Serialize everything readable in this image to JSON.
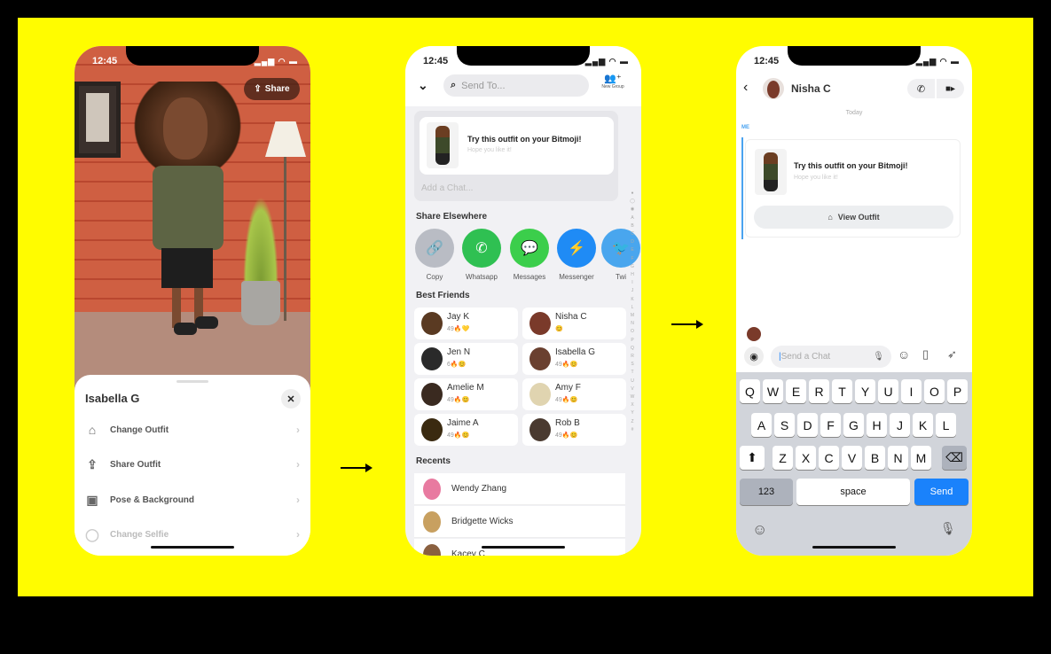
{
  "colors": {
    "brand_yellow": "#FFFC00",
    "send_blue": "#1a82fb",
    "accent_blue": "#4aa3f0"
  },
  "status": {
    "time": "12:45"
  },
  "screen1": {
    "share_button": "Share",
    "sheet_title": "Isabella G",
    "menu": [
      {
        "label": "Change Outfit",
        "icon": "hanger-icon"
      },
      {
        "label": "Share Outfit",
        "icon": "share-icon"
      },
      {
        "label": "Pose & Background",
        "icon": "image-icon"
      },
      {
        "label": "Change Selfie",
        "icon": "selfie-icon"
      }
    ]
  },
  "screen2": {
    "search_placeholder": "Send To...",
    "new_group": "New Group",
    "card_title": "Try this outfit on your Bitmoji!",
    "card_subtitle": "Hope you like it!",
    "add_chat_placeholder": "Add a Chat...",
    "share_heading": "Share Elsewhere",
    "share_targets": [
      {
        "label": "Copy",
        "color": "#b9bcc4",
        "icon": "link-icon"
      },
      {
        "label": "Whatsapp",
        "color": "#2fc052",
        "icon": "whatsapp-icon"
      },
      {
        "label": "Messages",
        "color": "#3bce4b",
        "icon": "message-icon"
      },
      {
        "label": "Messenger",
        "color": "#1f8bf5",
        "icon": "messenger-icon"
      },
      {
        "label": "Twi",
        "color": "#49a6ee",
        "icon": "twitter-icon"
      }
    ],
    "best_friends_heading": "Best Friends",
    "best_friends": [
      {
        "name": "Jay K",
        "streak": "49🔥💛"
      },
      {
        "name": "Nisha C",
        "streak": "😊"
      },
      {
        "name": "Jen N",
        "streak": "6🔥😊"
      },
      {
        "name": "Isabella G",
        "streak": "49🔥😊"
      },
      {
        "name": "Amelie M",
        "streak": "49🔥😊"
      },
      {
        "name": "Amy F",
        "streak": "49🔥😊"
      },
      {
        "name": "Jaime A",
        "streak": "49🔥😊"
      },
      {
        "name": "Rob B",
        "streak": "49🔥😊"
      }
    ],
    "recents_heading": "Recents",
    "recents": [
      "Wendy Zhang",
      "Bridgette Wicks",
      "Kacey C"
    ],
    "alphabet": "A B C D E F G H I J K L M N O P Q R S T U V W X Y Z #"
  },
  "screen3": {
    "contact": "Nisha C",
    "date": "Today",
    "sender": "ME",
    "card_title": "Try this outfit on your Bitmoji!",
    "card_subtitle": "Hope you like it!",
    "view_outfit": "View Outfit",
    "chat_placeholder": "Send a Chat",
    "keyboard": {
      "row1": [
        "Q",
        "W",
        "E",
        "R",
        "T",
        "Y",
        "U",
        "I",
        "O",
        "P"
      ],
      "row2": [
        "A",
        "S",
        "D",
        "F",
        "G",
        "H",
        "J",
        "K",
        "L"
      ],
      "row3": [
        "Z",
        "X",
        "C",
        "V",
        "B",
        "N",
        "M"
      ],
      "numbers": "123",
      "space": "space",
      "send": "Send"
    }
  }
}
